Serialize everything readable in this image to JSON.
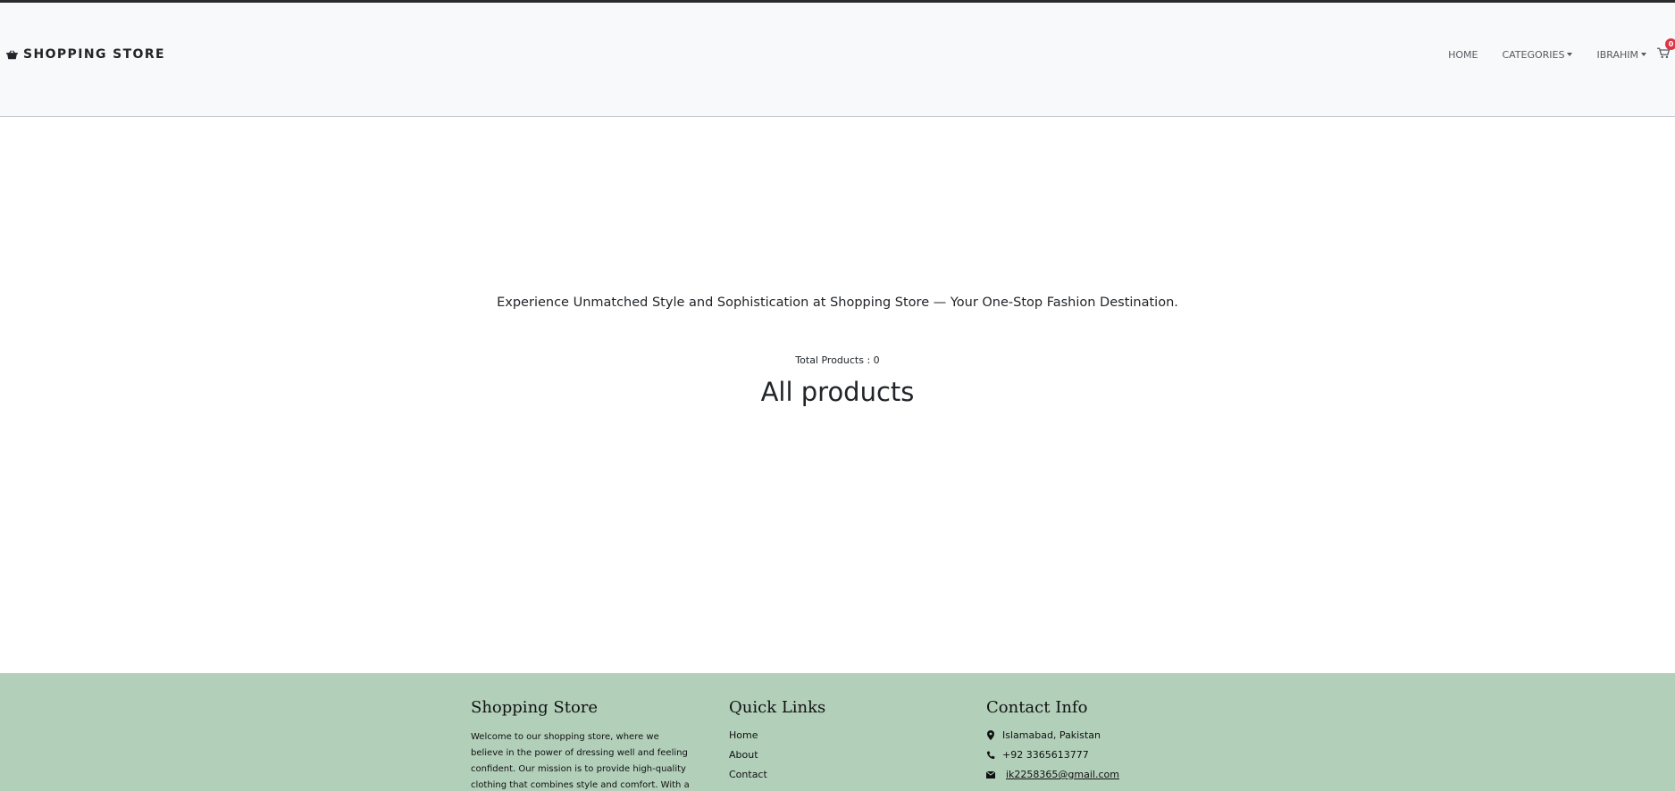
{
  "navbar": {
    "brand": "SHOPPING STORE",
    "links": {
      "home": "HOME",
      "categories": "CATEGORIES",
      "user": "IBRAHIM"
    },
    "cart_count": "0"
  },
  "main": {
    "tagline": "Experience Unmatched Style and Sophistication at Shopping Store — Your One-Stop Fashion Destination.",
    "total_products": "Total Products : 0",
    "heading": "All products"
  },
  "footer": {
    "about_title": "Shopping Store",
    "about_text": "Welcome to our shopping store, where we believe in the power of dressing well and feeling confident. Our mission is to provide high-quality clothing that combines style and comfort. With a wide selection of",
    "quick_links_title": "Quick Links",
    "quick_links": [
      "Home",
      "About",
      "Contact"
    ],
    "contact_title": "Contact Info",
    "contact": {
      "address": "Islamabad, Pakistan",
      "phone": "+92 3365613777",
      "email": "ik2258365@gmail.com"
    }
  },
  "colors": {
    "navbar_bg": "#f8f9fa",
    "footer_bg": "#b2cfba",
    "badge": "#dc3545"
  },
  "icons": {
    "brand": "basket-icon",
    "cart": "cart-icon",
    "address": "map-marker-icon",
    "phone": "phone-icon",
    "email": "envelope-icon"
  }
}
